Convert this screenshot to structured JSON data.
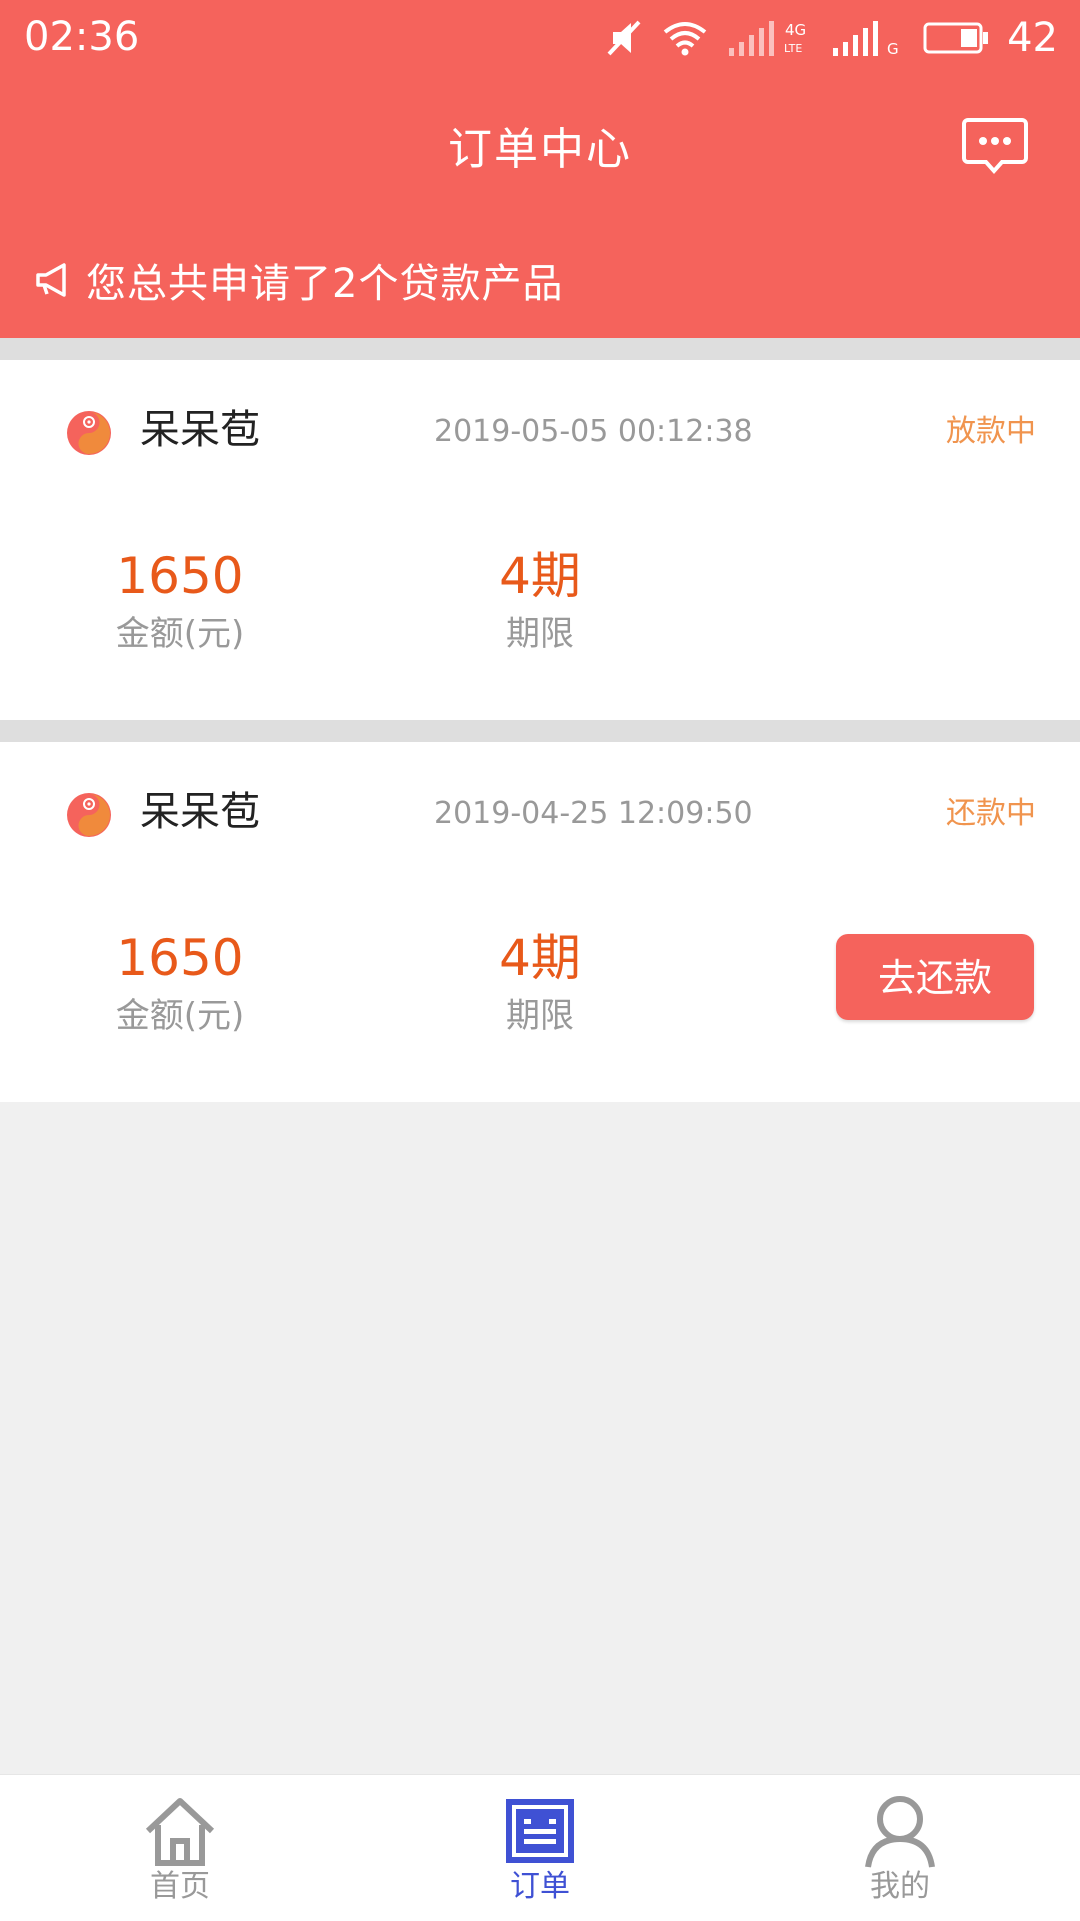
{
  "status_bar": {
    "time": "02:36",
    "battery": "42",
    "icons": [
      "mute-icon",
      "wifi-icon",
      "signal-4g-icon",
      "signal-g-icon",
      "battery-icon"
    ]
  },
  "header": {
    "title": "订单中心",
    "message_icon": "message-icon",
    "notice_icon": "megaphone-icon",
    "notice_text": "您总共申请了2个贷款产品"
  },
  "orders": [
    {
      "name": "呆呆苞",
      "time": "2019-05-05 00:12:38",
      "status": "放款中",
      "amount": "1650",
      "amount_label": "金额(元)",
      "term": "4期",
      "term_label": "期限"
    },
    {
      "name": "呆呆苞",
      "time": "2019-04-25 12:09:50",
      "status": "还款中",
      "amount": "1650",
      "amount_label": "金额(元)",
      "term": "4期",
      "term_label": "期限",
      "action_label": "去还款"
    }
  ],
  "tabs": [
    {
      "label": "首页",
      "icon": "home-icon",
      "active": false
    },
    {
      "label": "订单",
      "icon": "order-icon",
      "active": true
    },
    {
      "label": "我的",
      "icon": "user-icon",
      "active": false
    }
  ],
  "colors": {
    "brand": "#f5635c",
    "accent_orange": "#e8591a",
    "status_orange": "#f0944e",
    "tab_active": "#3f51d4"
  }
}
